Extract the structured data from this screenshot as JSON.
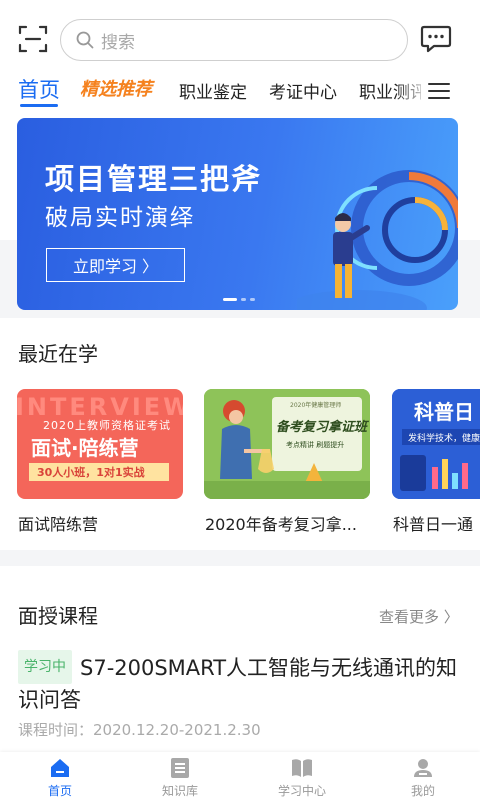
{
  "search": {
    "placeholder": "搜索"
  },
  "tabs": [
    {
      "label": "首页"
    },
    {
      "label": "精选推荐"
    },
    {
      "label": "职业鉴定"
    },
    {
      "label": "考证中心"
    },
    {
      "label": "职业测评"
    }
  ],
  "banner": {
    "title": "项目管理三把斧",
    "subtitle": "破局实时演绎",
    "button": "立即学习 〉"
  },
  "recent": {
    "title": "最近在学",
    "cards": [
      {
        "label": "面试陪练营",
        "bg_text": "INTERVIEW",
        "top_text": "2020上教师资格证考试",
        "main_text": "面试·陪练营",
        "tag_text": "30人小班，1对1实战"
      },
      {
        "label": "2020年备考复习拿...",
        "top_text": "2020年健康管理师",
        "main_text": "备考复习拿证班",
        "sub_text": "考点精讲  刷题提升"
      },
      {
        "label": "科普日一通",
        "main_text": "科普日",
        "tag_text": "发科学技术，健康科"
      }
    ]
  },
  "courses": {
    "title": "面授课程",
    "more": "查看更多 〉",
    "item": {
      "badge": "学习中",
      "title": "S7-200SMART人工智能与无线通讯的知识问答",
      "time": "课程时间：2020.12.20-2021.2.30"
    }
  },
  "nav": [
    {
      "label": "首页",
      "icon": "home-icon",
      "active": true
    },
    {
      "label": "知识库",
      "icon": "document-icon",
      "active": false
    },
    {
      "label": "学习中心",
      "icon": "book-icon",
      "active": false
    },
    {
      "label": "我的",
      "icon": "user-icon",
      "active": false
    }
  ],
  "colors": {
    "accent": "#1b6cf2",
    "featured": "#f5821f",
    "study_badge": "#49b36a"
  }
}
